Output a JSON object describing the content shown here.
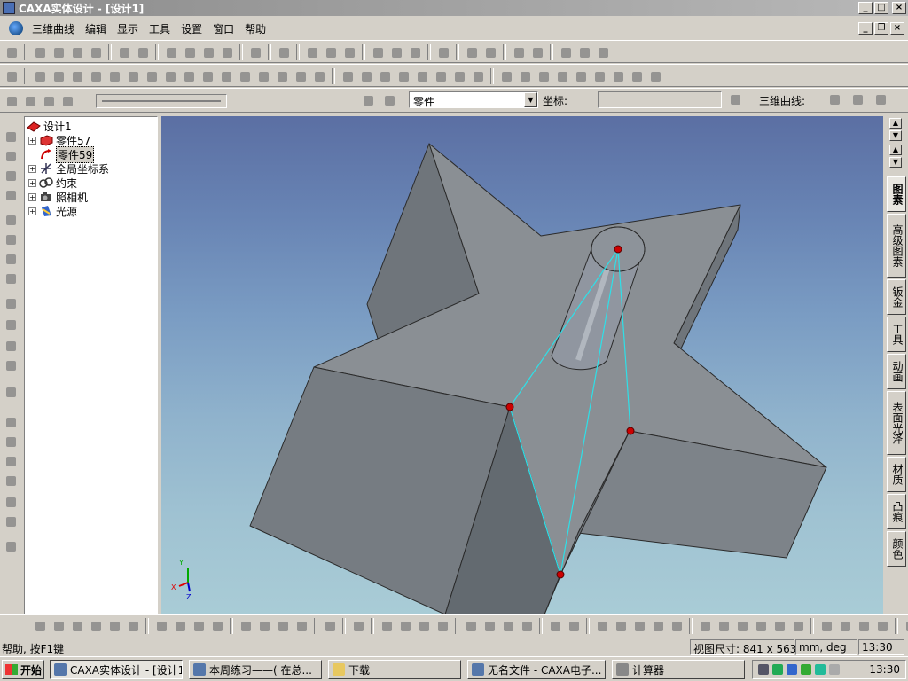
{
  "window": {
    "title": "CAXA实体设计 - [设计1]",
    "min": "_",
    "max": "□",
    "close": "×"
  },
  "menu": [
    "三维曲线",
    "编辑",
    "显示",
    "工具",
    "设置",
    "窗口",
    "帮助"
  ],
  "mdi": {
    "min": "_",
    "restore": "❐",
    "close": "×"
  },
  "row3": {
    "selector_value": "零件",
    "selector_arrow": "▼",
    "coord_label": "坐标:",
    "curve_label": "三维曲线:"
  },
  "tree": {
    "root": "设计1",
    "items": [
      {
        "label": "零件57",
        "expander": "+"
      },
      {
        "label": "零件59",
        "expander": ""
      },
      {
        "label": "全局坐标系",
        "expander": "+"
      },
      {
        "label": "约束",
        "expander": "+"
      },
      {
        "label": "照相机",
        "expander": "+"
      },
      {
        "label": "光源",
        "expander": "+"
      }
    ]
  },
  "right_tabs": [
    "图素",
    "高级图素",
    "钣金",
    "工具",
    "动画",
    "表面光泽",
    "材质",
    "凸痕",
    "颜色"
  ],
  "right_arrows": [
    "▲",
    "▼",
    "▲",
    "▼"
  ],
  "triad": {
    "x": "X",
    "y": "Y",
    "z": "Z"
  },
  "status": {
    "help": "帮助, 按F1键",
    "view_size": "视图尺寸: 841 x 563",
    "units": "mm, deg",
    "time": "13:30"
  },
  "taskbar": {
    "start": "开始",
    "tasks": [
      "CAXA实体设计 - [设计1]",
      "本周练习——( 在总...",
      "下载",
      "无名文件 - CAXA电子...",
      "计算器"
    ],
    "clock": "13:30"
  },
  "colors": {
    "part_face": "#8a8f94",
    "part_edge": "#2a2a2a",
    "guide_line": "#2ee0e8",
    "handle_point": "#cc0000"
  }
}
